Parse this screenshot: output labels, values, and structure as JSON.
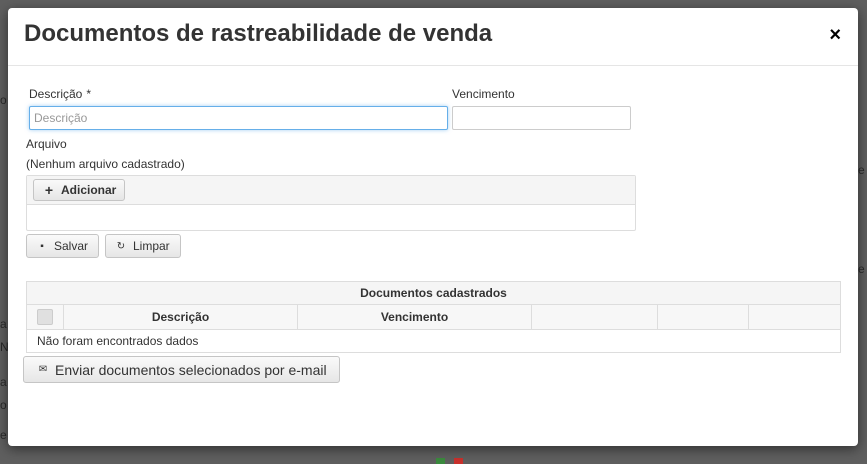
{
  "modal": {
    "title": "Documentos de rastreabilidade de venda",
    "close_label": "×"
  },
  "form": {
    "descricao_label": "Descrição",
    "required_mark": "*",
    "descricao_placeholder": "Descrição",
    "descricao_value": "",
    "vencimento_label": "Vencimento",
    "vencimento_value": "",
    "arquivo_label": "Arquivo",
    "arquivo_status": "(Nenhum arquivo cadastrado)",
    "add_label": "Adicionar",
    "save_label": "Salvar",
    "clear_label": "Limpar"
  },
  "table": {
    "caption": "Documentos cadastrados",
    "columns": [
      "Descrição",
      "Vencimento",
      "",
      "",
      ""
    ],
    "empty_text": "Não foram encontrados dados"
  },
  "email_button_label": "Enviar documentos selecionados por e-mail",
  "icons": {
    "close": "close-icon",
    "add": "plus-icon",
    "save": "save-icon",
    "clear": "undo-icon",
    "email": "envelope-icon"
  },
  "colors": {
    "overlay": "#5f5f5f",
    "focus_border": "#66afe9",
    "background_marker_red": "#c9302c",
    "background_marker_green": "#3b8a3e"
  }
}
